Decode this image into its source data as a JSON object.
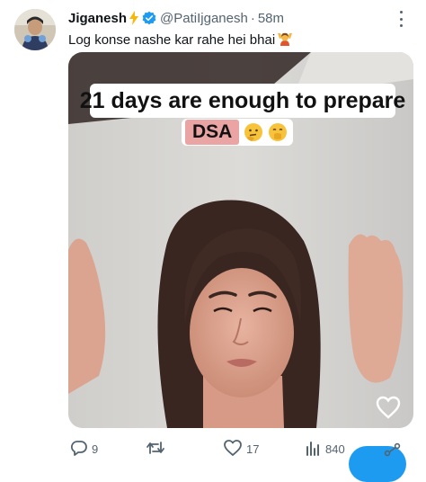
{
  "tweet": {
    "display_name": "Jiganesh",
    "handle": "@PatiIjganesh",
    "separator": "·",
    "time": "58m",
    "text": "Log konse nashe kar rahe hei bhai"
  },
  "media": {
    "caption_line1": "21 days are enough to prepare",
    "caption_chip": "DSA"
  },
  "actions": {
    "replies": "9",
    "likes": "17",
    "views": "840"
  },
  "colors": {
    "accent": "#1d9bf0",
    "verified": "#1d9bf0",
    "bolt": "#f5b80b",
    "secondary_text": "#536471",
    "chip_bg": "#eaa4a4"
  }
}
